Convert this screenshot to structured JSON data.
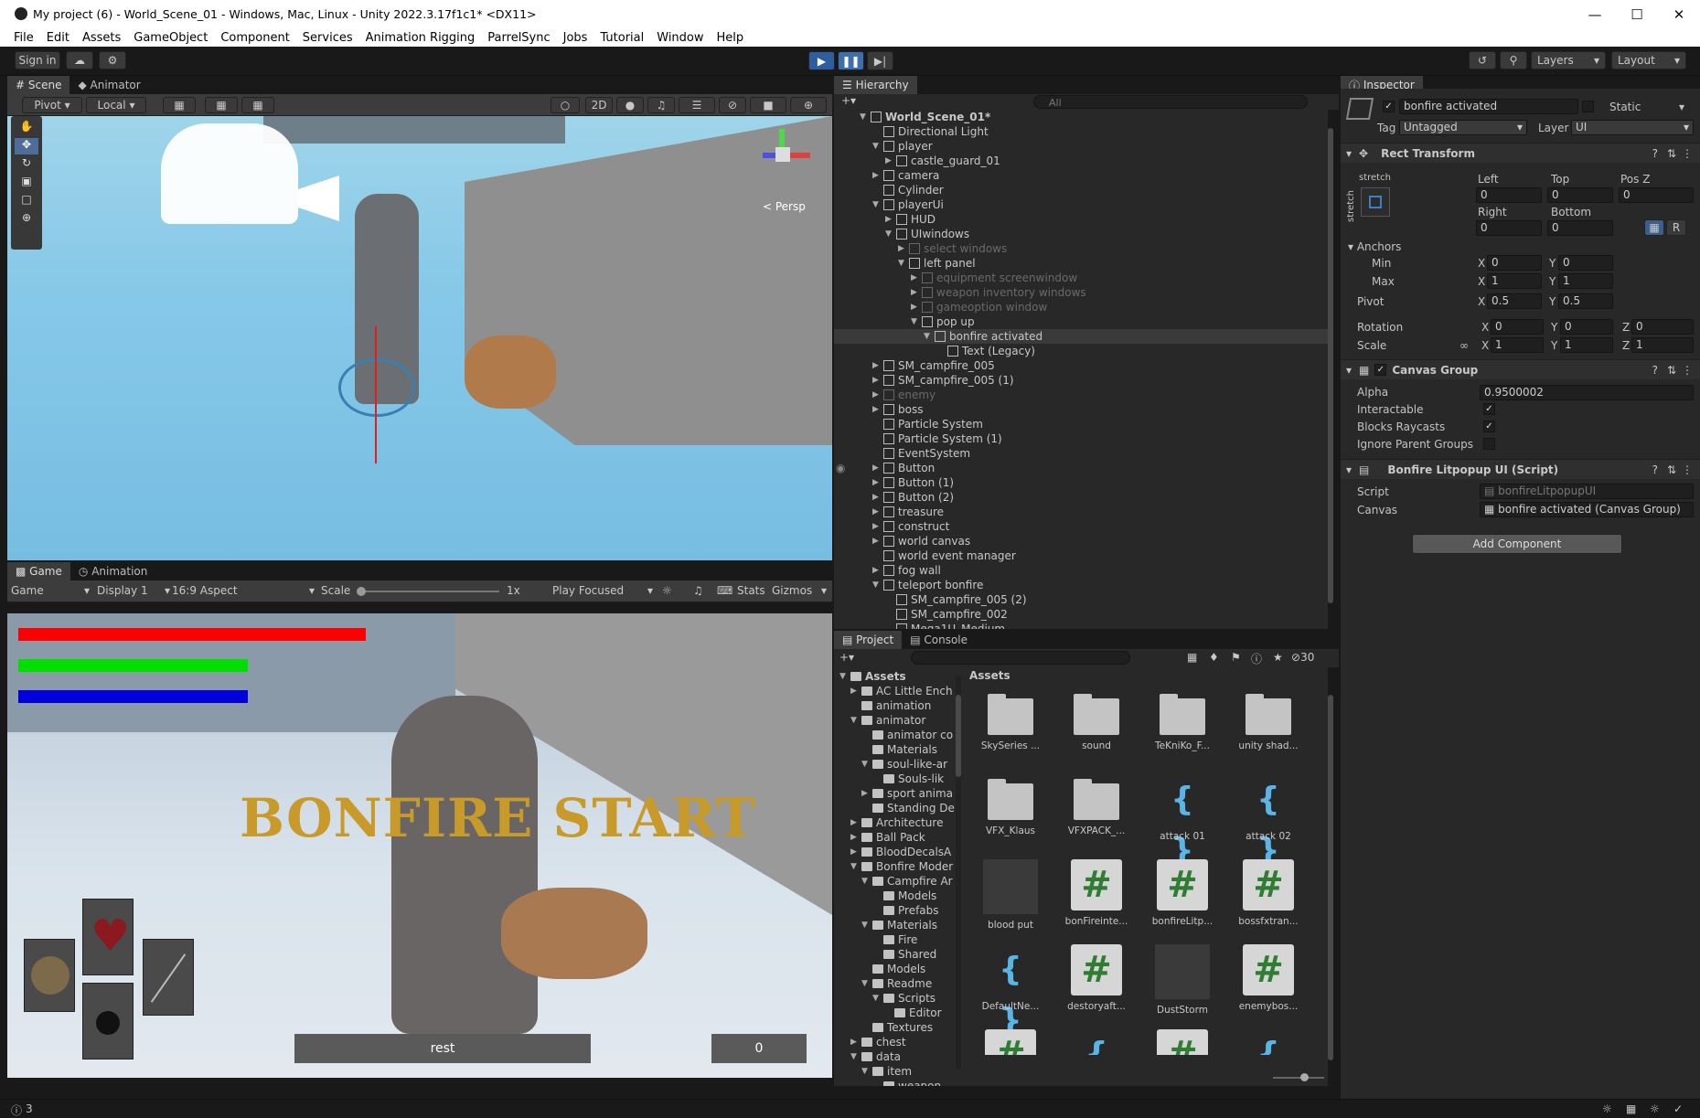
{
  "window": {
    "title": "My project (6) - World_Scene_01 - Windows, Mac, Linux - Unity 2022.3.17f1c1* <DX11>"
  },
  "menu": [
    "File",
    "Edit",
    "Assets",
    "GameObject",
    "Component",
    "Services",
    "Animation Rigging",
    "ParrelSync",
    "Jobs",
    "Tutorial",
    "Window",
    "Help"
  ],
  "toolbar": {
    "signin": "Sign in",
    "layers": "Layers",
    "layout": "Layout"
  },
  "scene": {
    "tabs": [
      "Scene",
      "Animator"
    ],
    "pivot": "Pivot",
    "local": "Local",
    "btn2d": "2D",
    "persp": "< Persp"
  },
  "game": {
    "tabs": [
      "Game",
      "Animation"
    ],
    "mode": "Game",
    "display": "Display 1",
    "aspect": "16:9 Aspect",
    "scale_label": "Scale",
    "scale_value": "1x",
    "play_focused": "Play Focused",
    "stats": "Stats",
    "gizmos": "Gizmos",
    "bonfire_text": "BONFIRE START",
    "rest_label": "rest",
    "counter": "0",
    "bars": [
      {
        "color": "#ff0000",
        "fill": 1.0
      },
      {
        "color": "#00e000",
        "fill": 0.66
      },
      {
        "color": "#0000dd",
        "fill": 0.66
      }
    ]
  },
  "hierarchy": {
    "tab": "Hierarchy",
    "search_placeholder": "All",
    "rows": [
      {
        "label": "World_Scene_01*",
        "depth": 0,
        "exp": "open",
        "bold": true,
        "dim": false,
        "sel": false,
        "scene": true
      },
      {
        "label": "Directional Light",
        "depth": 1,
        "exp": "",
        "dim": false,
        "sel": false
      },
      {
        "label": "player",
        "depth": 1,
        "exp": "open",
        "dim": false,
        "sel": false
      },
      {
        "label": "castle_guard_01",
        "depth": 2,
        "exp": "closed",
        "dim": false,
        "sel": false
      },
      {
        "label": "camera",
        "depth": 1,
        "exp": "closed",
        "dim": false,
        "sel": false
      },
      {
        "label": "Cylinder",
        "depth": 1,
        "exp": "",
        "dim": false,
        "sel": false
      },
      {
        "label": "playerUi",
        "depth": 1,
        "exp": "open",
        "dim": false,
        "sel": false
      },
      {
        "label": "HUD",
        "depth": 2,
        "exp": "closed",
        "dim": false,
        "sel": false
      },
      {
        "label": "UIwindows",
        "depth": 2,
        "exp": "open",
        "dim": false,
        "sel": false
      },
      {
        "label": "select windows",
        "depth": 3,
        "exp": "closed",
        "dim": true,
        "sel": false
      },
      {
        "label": "left panel",
        "depth": 3,
        "exp": "open",
        "dim": false,
        "sel": false
      },
      {
        "label": "equipment screenwindow",
        "depth": 4,
        "exp": "closed",
        "dim": true,
        "sel": false
      },
      {
        "label": "weapon inventory windows",
        "depth": 4,
        "exp": "closed",
        "dim": true,
        "sel": false
      },
      {
        "label": "gameoption window",
        "depth": 4,
        "exp": "closed",
        "dim": true,
        "sel": false
      },
      {
        "label": "pop up",
        "depth": 4,
        "exp": "open",
        "dim": false,
        "sel": false
      },
      {
        "label": "bonfire activated",
        "depth": 5,
        "exp": "open",
        "dim": false,
        "sel": true
      },
      {
        "label": "Text (Legacy)",
        "depth": 6,
        "exp": "",
        "dim": false,
        "sel": false
      },
      {
        "label": "SM_campfire_005",
        "depth": 1,
        "exp": "closed",
        "dim": false,
        "sel": false
      },
      {
        "label": "SM_campfire_005 (1)",
        "depth": 1,
        "exp": "closed",
        "dim": false,
        "sel": false
      },
      {
        "label": "enemy",
        "depth": 1,
        "exp": "closed",
        "dim": true,
        "sel": false
      },
      {
        "label": "boss",
        "depth": 1,
        "exp": "closed",
        "dim": false,
        "sel": false
      },
      {
        "label": "Particle System",
        "depth": 1,
        "exp": "",
        "dim": false,
        "sel": false
      },
      {
        "label": "Particle System (1)",
        "depth": 1,
        "exp": "",
        "dim": false,
        "sel": false
      },
      {
        "label": "EventSystem",
        "depth": 1,
        "exp": "",
        "dim": false,
        "sel": false
      },
      {
        "label": "Button",
        "depth": 1,
        "exp": "closed",
        "dim": false,
        "sel": false,
        "hover": true
      },
      {
        "label": "Button (1)",
        "depth": 1,
        "exp": "closed",
        "dim": false,
        "sel": false
      },
      {
        "label": "Button (2)",
        "depth": 1,
        "exp": "closed",
        "dim": false,
        "sel": false
      },
      {
        "label": "treasure",
        "depth": 1,
        "exp": "closed",
        "dim": false,
        "sel": false
      },
      {
        "label": "construct",
        "depth": 1,
        "exp": "closed",
        "dim": false,
        "sel": false
      },
      {
        "label": "world canvas",
        "depth": 1,
        "exp": "closed",
        "dim": false,
        "sel": false
      },
      {
        "label": "world event manager",
        "depth": 1,
        "exp": "",
        "dim": false,
        "sel": false
      },
      {
        "label": "fog wall",
        "depth": 1,
        "exp": "closed",
        "dim": false,
        "sel": false
      },
      {
        "label": "teleport bonfire",
        "depth": 1,
        "exp": "open",
        "dim": false,
        "sel": false
      },
      {
        "label": "SM_campfire_005 (2)",
        "depth": 2,
        "exp": "",
        "dim": false,
        "sel": false
      },
      {
        "label": "SM_campfire_002",
        "depth": 2,
        "exp": "",
        "dim": false,
        "sel": false
      },
      {
        "label": "Mega1U_Medium",
        "depth": 2,
        "exp": "",
        "dim": false,
        "sel": false
      }
    ]
  },
  "inspector": {
    "tab": "Inspector",
    "object_name": "bonfire activated",
    "static_label": "Static",
    "tag_label": "Tag",
    "tag_value": "Untagged",
    "layer_label": "Layer",
    "layer_value": "UI",
    "rect": {
      "title": "Rect Transform",
      "stretch_top": "stretch",
      "stretch_side": "stretch",
      "left_label": "Left",
      "top_label": "Top",
      "posz_label": "Pos Z",
      "left": "0",
      "top": "0",
      "posz": "0",
      "right_label": "Right",
      "bottom_label": "Bottom",
      "right": "0",
      "bottom": "0",
      "r_btn": "R",
      "anchors_label": "Anchors",
      "min_label": "Min",
      "max_label": "Max",
      "min_x": "0",
      "min_y": "0",
      "max_x": "1",
      "max_y": "1",
      "pivot_label": "Pivot",
      "pivot_x": "0.5",
      "pivot_y": "0.5",
      "rotation_label": "Rotation",
      "rot_x": "0",
      "rot_y": "0",
      "rot_z": "0",
      "scale_label": "Scale",
      "scale_x": "1",
      "scale_y": "1",
      "scale_z": "1",
      "x": "X",
      "y": "Y",
      "z": "Z"
    },
    "canvas_group": {
      "title": "Canvas Group",
      "alpha_label": "Alpha",
      "alpha": "0.9500002",
      "interactable_label": "Interactable",
      "blocks_label": "Blocks Raycasts",
      "ignore_label": "Ignore Parent Groups"
    },
    "script": {
      "title": "Bonfire Litpopup UI (Script)",
      "script_label": "Script",
      "script_value": "bonfireLitpopupUI",
      "canvas_label": "Canvas",
      "canvas_value": "bonfire activated (Canvas Group)"
    },
    "add_component": "Add Component"
  },
  "project": {
    "tabs": [
      "Project",
      "Console"
    ],
    "badge_count": "30",
    "assets_header": "Assets",
    "tree": [
      {
        "label": "Assets",
        "depth": 0,
        "exp": "open",
        "bold": true
      },
      {
        "label": "AC Little Ench",
        "depth": 1,
        "exp": "closed"
      },
      {
        "label": "animation",
        "depth": 1,
        "exp": ""
      },
      {
        "label": "animator",
        "depth": 1,
        "exp": "open"
      },
      {
        "label": "animator co",
        "depth": 2,
        "exp": ""
      },
      {
        "label": "Materials",
        "depth": 2,
        "exp": ""
      },
      {
        "label": "soul-like-ar",
        "depth": 2,
        "exp": "open"
      },
      {
        "label": "Souls-lik",
        "depth": 3,
        "exp": ""
      },
      {
        "label": "sport anima",
        "depth": 2,
        "exp": "closed"
      },
      {
        "label": "Standing De",
        "depth": 2,
        "exp": ""
      },
      {
        "label": "Architecture",
        "depth": 1,
        "exp": "closed"
      },
      {
        "label": "Ball Pack",
        "depth": 1,
        "exp": "closed"
      },
      {
        "label": "BloodDecalsA",
        "depth": 1,
        "exp": "closed"
      },
      {
        "label": "Bonfire Moder",
        "depth": 1,
        "exp": "open"
      },
      {
        "label": "Campfire Ar",
        "depth": 2,
        "exp": "open"
      },
      {
        "label": "Models",
        "depth": 3,
        "exp": ""
      },
      {
        "label": "Prefabs",
        "depth": 3,
        "exp": ""
      },
      {
        "label": "Materials",
        "depth": 2,
        "exp": "open"
      },
      {
        "label": "Fire",
        "depth": 3,
        "exp": ""
      },
      {
        "label": "Shared",
        "depth": 3,
        "exp": ""
      },
      {
        "label": "Models",
        "depth": 2,
        "exp": ""
      },
      {
        "label": "Readme",
        "depth": 2,
        "exp": "open"
      },
      {
        "label": "Scripts",
        "depth": 3,
        "exp": "open"
      },
      {
        "label": "Editor",
        "depth": 4,
        "exp": ""
      },
      {
        "label": "Textures",
        "depth": 2,
        "exp": ""
      },
      {
        "label": "chest",
        "depth": 1,
        "exp": "closed"
      },
      {
        "label": "data",
        "depth": 1,
        "exp": "open"
      },
      {
        "label": "item",
        "depth": 2,
        "exp": "open"
      },
      {
        "label": "weapon",
        "depth": 3,
        "exp": ""
      }
    ],
    "assets": [
      {
        "label": "SkySeries ...",
        "kind": "folder"
      },
      {
        "label": "sound",
        "kind": "folder"
      },
      {
        "label": "TeKniKo_F...",
        "kind": "folder"
      },
      {
        "label": "unity shad...",
        "kind": "folder"
      },
      {
        "label": "VFX_Klaus",
        "kind": "folder"
      },
      {
        "label": "VFXPACK_...",
        "kind": "folder"
      },
      {
        "label": "attack 01",
        "kind": "prefab"
      },
      {
        "label": "attack 02",
        "kind": "prefab"
      },
      {
        "label": "blood put",
        "kind": "gray"
      },
      {
        "label": "bonFireinte...",
        "kind": "cs"
      },
      {
        "label": "bonfireLitp...",
        "kind": "cs"
      },
      {
        "label": "bossfxtran...",
        "kind": "cs"
      },
      {
        "label": "DefaultNe...",
        "kind": "prefab"
      },
      {
        "label": "destoryaft...",
        "kind": "cs"
      },
      {
        "label": "DustStorm",
        "kind": "gray"
      },
      {
        "label": "enemybos...",
        "kind": "cs"
      },
      {
        "label": "",
        "kind": "cs"
      },
      {
        "label": "",
        "kind": "prefab"
      },
      {
        "label": "",
        "kind": "cs"
      },
      {
        "label": "",
        "kind": "prefab"
      }
    ]
  },
  "status": {
    "count": "3"
  }
}
